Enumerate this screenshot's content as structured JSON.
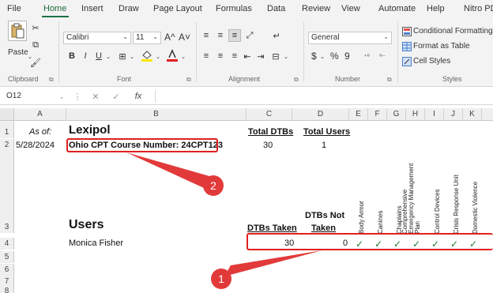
{
  "ribbon": {
    "tabs": [
      "File",
      "Home",
      "Insert",
      "Draw",
      "Page Layout",
      "Formulas",
      "Data",
      "Review",
      "View",
      "Automate",
      "Help",
      "Nitro PD"
    ],
    "active_tab": "Home",
    "clipboard": {
      "paste_label": "Paste",
      "group_label": "Clipboard"
    },
    "font": {
      "font_name": "Calibri",
      "font_size": "11",
      "group_label": "Font",
      "grow_glyph": "A^",
      "shrink_glyph": "A˅"
    },
    "alignment": {
      "group_label": "Alignment"
    },
    "number": {
      "format": "General",
      "group_label": "Number",
      "currency": "$",
      "percent": "%",
      "comma": "9"
    },
    "styles": {
      "conditional_formatting": "Conditional Formatting",
      "format_as_table": "Format as Table",
      "cell_styles": "Cell Styles",
      "group_label": "Styles"
    },
    "accent_color": "#1e7145"
  },
  "formula_bar": {
    "name_box": "O12",
    "fx": "fx",
    "value": ""
  },
  "grid": {
    "columns": [
      "A",
      "B",
      "C",
      "D",
      "E",
      "F",
      "G",
      "H",
      "I",
      "J",
      "K"
    ],
    "rows": [
      "1",
      "2",
      "3",
      "4",
      "5",
      "6",
      "7",
      "8"
    ],
    "cells": {
      "A1": "As of:",
      "B1": "Lexipol",
      "C1": "Total DTBs",
      "D1": "Total Users",
      "A2": "5/28/2024",
      "B2": "Ohio CPT Course Number: 24CPT123",
      "C2": "30",
      "D2": "1",
      "B3": "Users",
      "C3": "DTBs Taken",
      "D3_line1": "DTBs Not",
      "D3_line2": "Taken",
      "B4": "Monica  Fisher",
      "C4": "30",
      "D4": "0"
    },
    "rotated_headers": [
      "Body Armor",
      "Canines",
      "Chaplains",
      "Comprehensive Emergency Management Plan",
      "Control Devices",
      "Crisis Response Unit",
      "Domestic Violence"
    ],
    "check_glyph": "✓",
    "check_color": "#1e7b34"
  },
  "annotations": {
    "badge_1": "1",
    "badge_2": "2",
    "color": "#e02020"
  }
}
